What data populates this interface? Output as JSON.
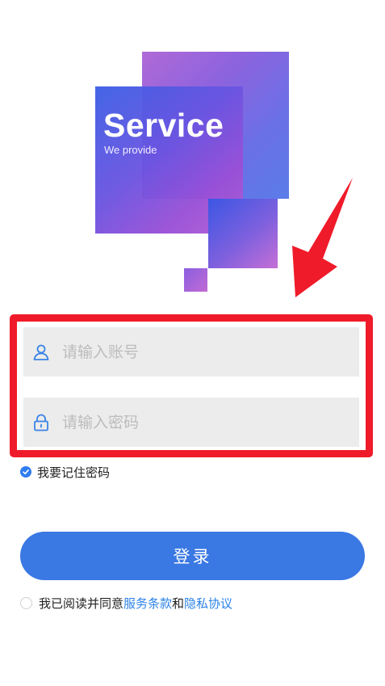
{
  "hero": {
    "title": "Service",
    "subtitle": "We provide"
  },
  "form": {
    "account_placeholder": "请输入账号",
    "password_placeholder": "请输入密码",
    "remember_label": "我要记住密码",
    "remember_checked": true,
    "login_label": "登录"
  },
  "agreement": {
    "prefix": "我已阅读并同意",
    "terms_link": "服务条款",
    "joiner": "和",
    "privacy_link": "隐私协议",
    "checked": false
  },
  "colors": {
    "accent": "#3a78e3",
    "link": "#2b82e8",
    "highlight": "#ef1b2a",
    "field_bg": "#ececec"
  },
  "icons": {
    "account": "user-icon",
    "password": "lock-icon",
    "remember": "check-circle-icon",
    "annotation": "red-arrow-icon"
  }
}
